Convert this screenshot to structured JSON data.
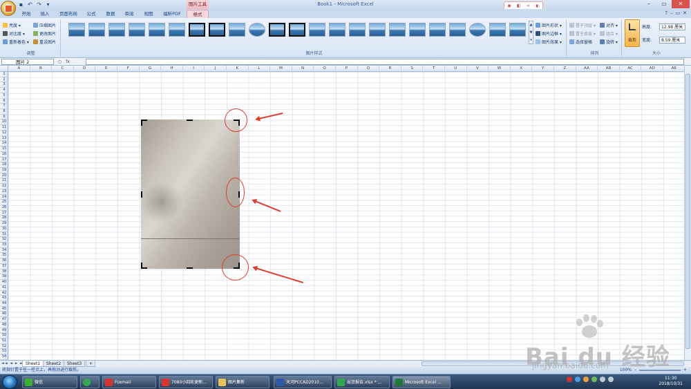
{
  "window": {
    "title": "Book1 - Microsoft Excel",
    "context_tool": "图片工具",
    "float_toolbar": [
      "◉",
      "◧",
      "∞",
      "◐"
    ]
  },
  "tabs": [
    {
      "label": "开始"
    },
    {
      "label": "插入"
    },
    {
      "label": "页面布局"
    },
    {
      "label": "公式"
    },
    {
      "label": "数据"
    },
    {
      "label": "审阅"
    },
    {
      "label": "视图"
    },
    {
      "label": "福昕PDF"
    },
    {
      "label": "格式"
    }
  ],
  "ribbon": {
    "adjust": {
      "label": "调整",
      "items": [
        "亮度 ▾",
        "对比度 ▾",
        "重新着色 ▾",
        "压缩图片",
        "更改图片",
        "重设图片"
      ]
    },
    "styles": {
      "label": "图片样式"
    },
    "picture_options": [
      "图片形状 ▾",
      "图片边框 ▾",
      "图片效果 ▾"
    ],
    "arrange": {
      "label": "排列",
      "items": [
        "置于顶层 ▾",
        "置于底层 ▾",
        "选择窗格",
        "对齐 ▾",
        "组合 ▾",
        "旋转 ▾"
      ]
    },
    "size": {
      "label": "大小",
      "crop_label": "裁剪",
      "height_label": "高度:",
      "height_value": "12.98 厘米",
      "width_label": "宽度:",
      "width_value": "8.59 厘米"
    }
  },
  "formula_bar": {
    "name_box": "图片 2",
    "fx": "fx",
    "content": ""
  },
  "columns": [
    "A",
    "B",
    "C",
    "D",
    "E",
    "F",
    "G",
    "H",
    "I",
    "J",
    "K",
    "L",
    "M",
    "N",
    "O",
    "P",
    "Q",
    "R",
    "S",
    "T",
    "U",
    "V",
    "W",
    "X",
    "Y",
    "Z",
    "AA",
    "AB",
    "AC",
    "AD",
    "AE"
  ],
  "rows": [
    "1",
    "2",
    "3",
    "4",
    "5",
    "6",
    "7",
    "8",
    "9",
    "10",
    "11",
    "12",
    "13",
    "14",
    "15",
    "16",
    "17",
    "18",
    "19",
    "20",
    "21",
    "22",
    "23",
    "24",
    "25",
    "26",
    "27",
    "28",
    "29",
    "30",
    "31",
    "32",
    "33",
    "34",
    "35",
    "36",
    "37",
    "38",
    "39",
    "40",
    "41",
    "42",
    "43",
    "44",
    "45",
    "46",
    "47",
    "48",
    "49",
    "50",
    "51",
    "52",
    "53",
    "54"
  ],
  "sheets": [
    "Sheet1",
    "Sheet2",
    "Sheet3"
  ],
  "status": {
    "message": "将指针置于任一控点上，再拖动进行裁剪。",
    "zoom": "100%"
  },
  "taskbar": {
    "items": [
      {
        "label": "微信",
        "color": "#3cb034"
      },
      {
        "label": "",
        "color": "#35a853"
      },
      {
        "label": "Foxmail",
        "color": "#d8342c"
      },
      {
        "label": "7080小四轮更新...",
        "color": "#d8342c"
      },
      {
        "label": "图片集新",
        "color": "#e9c25a"
      },
      {
        "label": "天河PCCAD2010...",
        "color": "#2c5aa8"
      },
      {
        "label": "出货报告.xlsx * ...",
        "color": "#2fa84f"
      },
      {
        "label": "Microsoft Excel ...",
        "color": "#1f7a3a"
      }
    ],
    "time": "11:30",
    "date": "2018/10/31"
  },
  "watermark": {
    "text": "Bai du 经验",
    "url": "jingyan.baidu.com"
  },
  "colors": {
    "annotation": "#e23b2b",
    "ribbon_bg": "#d7e4f4",
    "context_tab": "#f4d8dd"
  }
}
